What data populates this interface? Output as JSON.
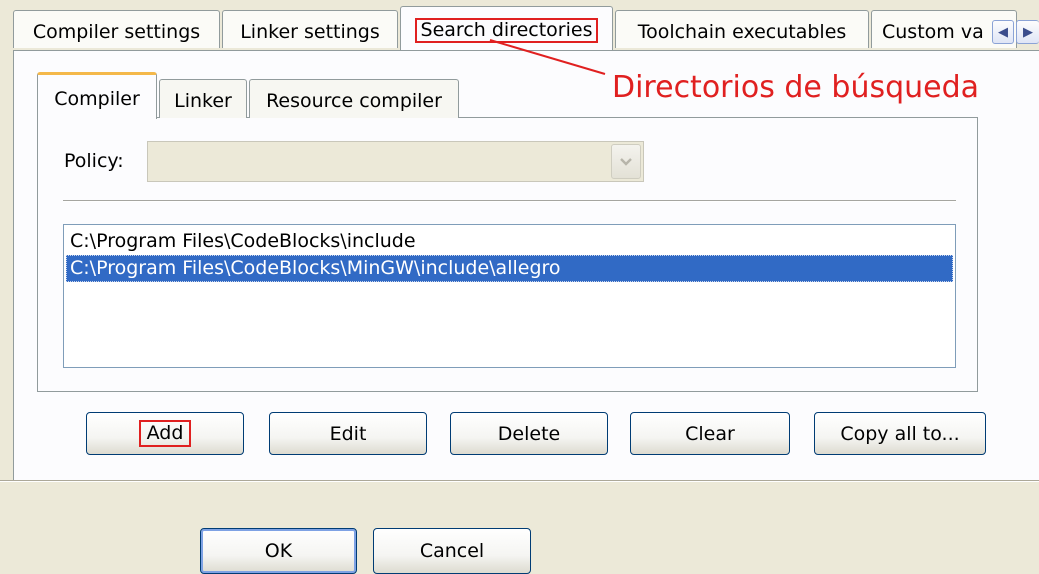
{
  "top_tabs": [
    {
      "label": "Compiler settings",
      "active": false
    },
    {
      "label": "Linker settings",
      "active": false
    },
    {
      "label": "Search directories",
      "active": true
    },
    {
      "label": "Toolchain executables",
      "active": false
    },
    {
      "label": "Custom va",
      "active": false
    }
  ],
  "inner_tabs": [
    {
      "label": "Compiler",
      "active": true
    },
    {
      "label": "Linker",
      "active": false
    },
    {
      "label": "Resource compiler",
      "active": false
    }
  ],
  "annotation": "Directorios de búsqueda",
  "policy": {
    "label": "Policy:",
    "value": ""
  },
  "directories": [
    {
      "path": "C:\\Program Files\\CodeBlocks\\include",
      "selected": false
    },
    {
      "path": "C:\\Program Files\\CodeBlocks\\MinGW\\include\\allegro",
      "selected": true
    }
  ],
  "actions": {
    "add": "Add",
    "edit": "Edit",
    "delete": "Delete",
    "clear": "Clear",
    "copy_all": "Copy all to..."
  },
  "dialog": {
    "ok": "OK",
    "cancel": "Cancel"
  },
  "colors": {
    "annotation_red": "#e02020",
    "selection_blue": "#316ac5",
    "active_tab_accent": "#f4b84a"
  }
}
